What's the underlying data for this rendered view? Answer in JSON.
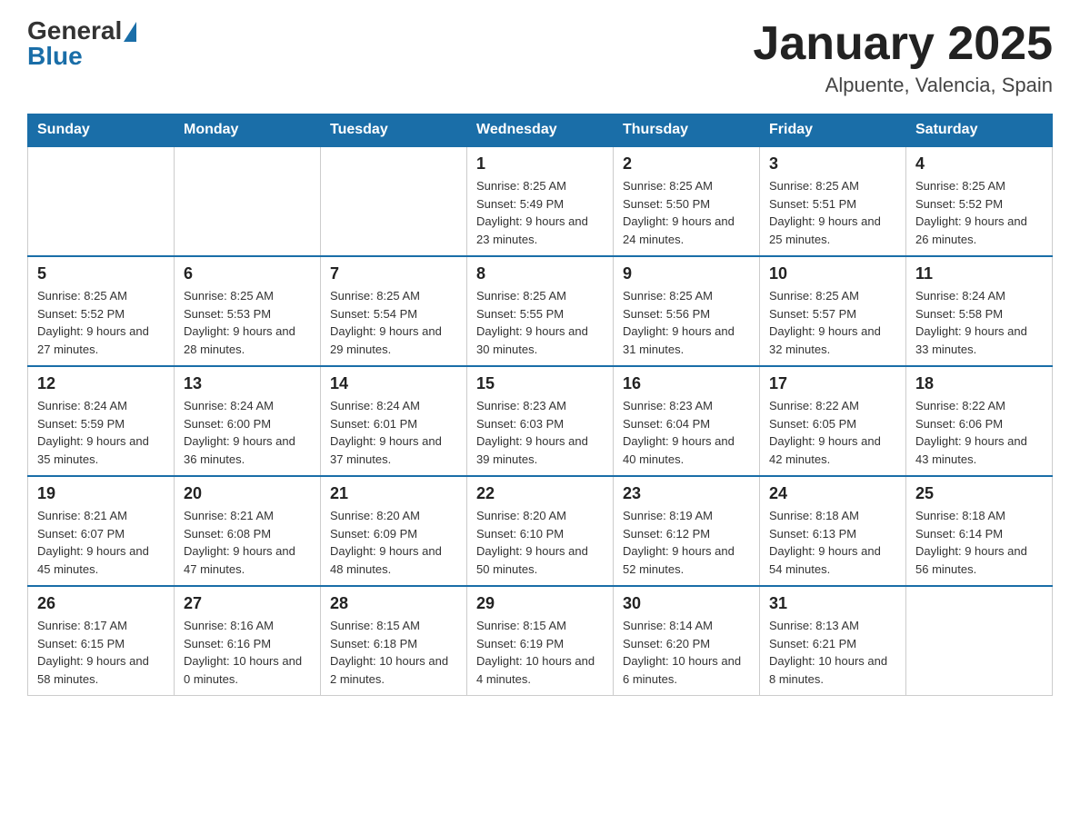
{
  "header": {
    "logo_general": "General",
    "logo_blue": "Blue",
    "title": "January 2025",
    "subtitle": "Alpuente, Valencia, Spain"
  },
  "columns": [
    "Sunday",
    "Monday",
    "Tuesday",
    "Wednesday",
    "Thursday",
    "Friday",
    "Saturday"
  ],
  "weeks": [
    [
      {
        "day": "",
        "info": ""
      },
      {
        "day": "",
        "info": ""
      },
      {
        "day": "",
        "info": ""
      },
      {
        "day": "1",
        "info": "Sunrise: 8:25 AM\nSunset: 5:49 PM\nDaylight: 9 hours\nand 23 minutes."
      },
      {
        "day": "2",
        "info": "Sunrise: 8:25 AM\nSunset: 5:50 PM\nDaylight: 9 hours\nand 24 minutes."
      },
      {
        "day": "3",
        "info": "Sunrise: 8:25 AM\nSunset: 5:51 PM\nDaylight: 9 hours\nand 25 minutes."
      },
      {
        "day": "4",
        "info": "Sunrise: 8:25 AM\nSunset: 5:52 PM\nDaylight: 9 hours\nand 26 minutes."
      }
    ],
    [
      {
        "day": "5",
        "info": "Sunrise: 8:25 AM\nSunset: 5:52 PM\nDaylight: 9 hours\nand 27 minutes."
      },
      {
        "day": "6",
        "info": "Sunrise: 8:25 AM\nSunset: 5:53 PM\nDaylight: 9 hours\nand 28 minutes."
      },
      {
        "day": "7",
        "info": "Sunrise: 8:25 AM\nSunset: 5:54 PM\nDaylight: 9 hours\nand 29 minutes."
      },
      {
        "day": "8",
        "info": "Sunrise: 8:25 AM\nSunset: 5:55 PM\nDaylight: 9 hours\nand 30 minutes."
      },
      {
        "day": "9",
        "info": "Sunrise: 8:25 AM\nSunset: 5:56 PM\nDaylight: 9 hours\nand 31 minutes."
      },
      {
        "day": "10",
        "info": "Sunrise: 8:25 AM\nSunset: 5:57 PM\nDaylight: 9 hours\nand 32 minutes."
      },
      {
        "day": "11",
        "info": "Sunrise: 8:24 AM\nSunset: 5:58 PM\nDaylight: 9 hours\nand 33 minutes."
      }
    ],
    [
      {
        "day": "12",
        "info": "Sunrise: 8:24 AM\nSunset: 5:59 PM\nDaylight: 9 hours\nand 35 minutes."
      },
      {
        "day": "13",
        "info": "Sunrise: 8:24 AM\nSunset: 6:00 PM\nDaylight: 9 hours\nand 36 minutes."
      },
      {
        "day": "14",
        "info": "Sunrise: 8:24 AM\nSunset: 6:01 PM\nDaylight: 9 hours\nand 37 minutes."
      },
      {
        "day": "15",
        "info": "Sunrise: 8:23 AM\nSunset: 6:03 PM\nDaylight: 9 hours\nand 39 minutes."
      },
      {
        "day": "16",
        "info": "Sunrise: 8:23 AM\nSunset: 6:04 PM\nDaylight: 9 hours\nand 40 minutes."
      },
      {
        "day": "17",
        "info": "Sunrise: 8:22 AM\nSunset: 6:05 PM\nDaylight: 9 hours\nand 42 minutes."
      },
      {
        "day": "18",
        "info": "Sunrise: 8:22 AM\nSunset: 6:06 PM\nDaylight: 9 hours\nand 43 minutes."
      }
    ],
    [
      {
        "day": "19",
        "info": "Sunrise: 8:21 AM\nSunset: 6:07 PM\nDaylight: 9 hours\nand 45 minutes."
      },
      {
        "day": "20",
        "info": "Sunrise: 8:21 AM\nSunset: 6:08 PM\nDaylight: 9 hours\nand 47 minutes."
      },
      {
        "day": "21",
        "info": "Sunrise: 8:20 AM\nSunset: 6:09 PM\nDaylight: 9 hours\nand 48 minutes."
      },
      {
        "day": "22",
        "info": "Sunrise: 8:20 AM\nSunset: 6:10 PM\nDaylight: 9 hours\nand 50 minutes."
      },
      {
        "day": "23",
        "info": "Sunrise: 8:19 AM\nSunset: 6:12 PM\nDaylight: 9 hours\nand 52 minutes."
      },
      {
        "day": "24",
        "info": "Sunrise: 8:18 AM\nSunset: 6:13 PM\nDaylight: 9 hours\nand 54 minutes."
      },
      {
        "day": "25",
        "info": "Sunrise: 8:18 AM\nSunset: 6:14 PM\nDaylight: 9 hours\nand 56 minutes."
      }
    ],
    [
      {
        "day": "26",
        "info": "Sunrise: 8:17 AM\nSunset: 6:15 PM\nDaylight: 9 hours\nand 58 minutes."
      },
      {
        "day": "27",
        "info": "Sunrise: 8:16 AM\nSunset: 6:16 PM\nDaylight: 10 hours\nand 0 minutes."
      },
      {
        "day": "28",
        "info": "Sunrise: 8:15 AM\nSunset: 6:18 PM\nDaylight: 10 hours\nand 2 minutes."
      },
      {
        "day": "29",
        "info": "Sunrise: 8:15 AM\nSunset: 6:19 PM\nDaylight: 10 hours\nand 4 minutes."
      },
      {
        "day": "30",
        "info": "Sunrise: 8:14 AM\nSunset: 6:20 PM\nDaylight: 10 hours\nand 6 minutes."
      },
      {
        "day": "31",
        "info": "Sunrise: 8:13 AM\nSunset: 6:21 PM\nDaylight: 10 hours\nand 8 minutes."
      },
      {
        "day": "",
        "info": ""
      }
    ]
  ]
}
